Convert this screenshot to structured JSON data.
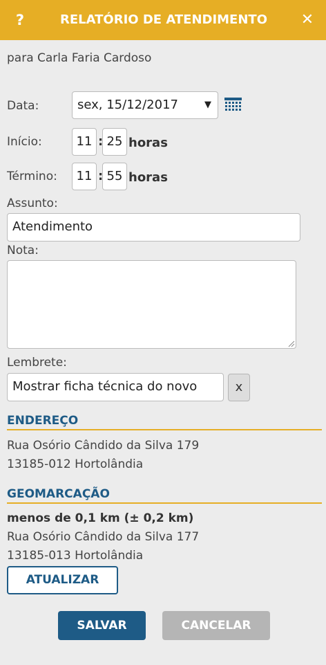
{
  "header": {
    "help_label": "?",
    "title": "RELATÓRIO DE ATENDIMENTO",
    "close_label": "✕"
  },
  "recipient": "para Carla Faria Cardoso",
  "date": {
    "label": "Data:",
    "value": "sex, 15/12/2017",
    "caret": "▼",
    "icon": "calendar-icon"
  },
  "start": {
    "label": "Início:",
    "hour": "11",
    "minute": "25",
    "colon": ":",
    "unit": "horas"
  },
  "end": {
    "label": "Término:",
    "hour": "11",
    "minute": "55",
    "colon": ":",
    "unit": "horas"
  },
  "subject": {
    "label": "Assunto:",
    "value": "Atendimento"
  },
  "note": {
    "label": "Nota:",
    "value": ""
  },
  "reminder": {
    "label": "Lembrete:",
    "value": "Mostrar ficha técnica do novo",
    "clear_label": "x"
  },
  "address": {
    "title": "ENDEREÇO",
    "line1": "Rua Osório Cândido da Silva 179",
    "line2": "13185-012 Hortolândia"
  },
  "geo": {
    "title": "GEOMARCAÇÃO",
    "distance": "menos de 0,1 km (± 0,2 km)",
    "line1": "Rua Osório Cândido da Silva 177",
    "line2": "13185-013 Hortolândia",
    "update_label": "ATUALIZAR"
  },
  "actions": {
    "save_label": "SALVAR",
    "cancel_label": "CANCELAR"
  },
  "colors": {
    "header": "#e6ae25",
    "primary": "#1e5b86",
    "disabled": "#b5b5b5"
  }
}
